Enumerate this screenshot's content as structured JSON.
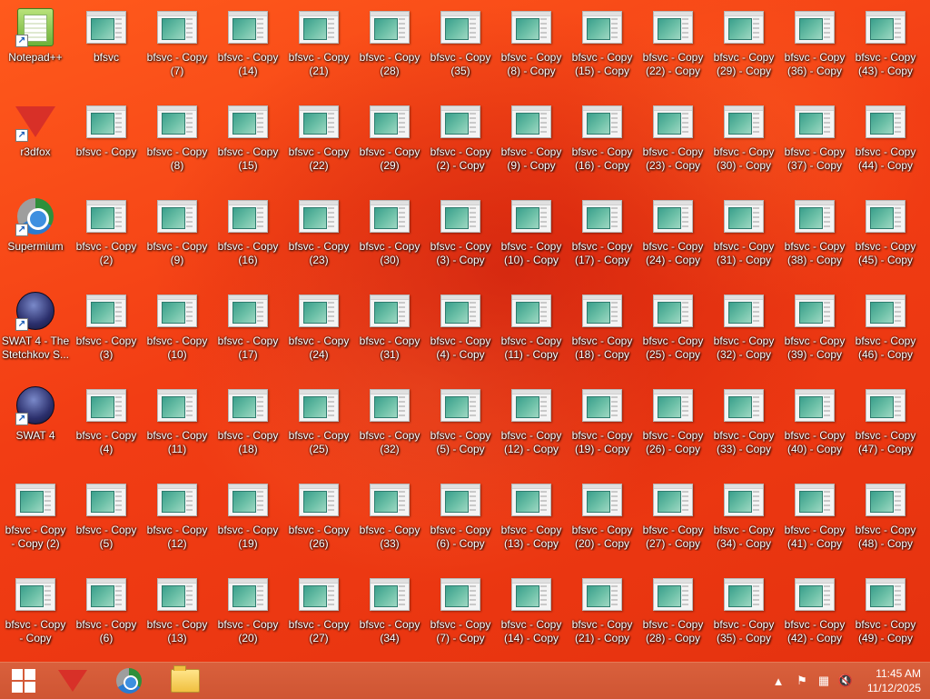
{
  "desktop": {
    "shortcuts": [
      {
        "label": "Notepad++",
        "icon": "notepad-plus-plus-icon"
      },
      {
        "label": "r3dfox",
        "icon": "r3dfox-icon"
      },
      {
        "label": "Supermium",
        "icon": "supermium-icon"
      },
      {
        "label": "SWAT 4 - The\nStetchkov S...",
        "icon": "swat4-tss-icon"
      },
      {
        "label": "SWAT 4",
        "icon": "swat4-icon"
      },
      {
        "label": "bfsvc - Copy\n- Copy (2)",
        "icon": "executable-icon"
      },
      {
        "label": "bfsvc - Copy\n- Copy",
        "icon": "executable-icon"
      }
    ],
    "file_labels": [
      [
        "bfsvc",
        "bfsvc - Copy\n(7)",
        "bfsvc - Copy\n(14)",
        "bfsvc - Copy\n(21)",
        "bfsvc - Copy\n(28)",
        "bfsvc - Copy\n(35)",
        "bfsvc - Copy\n(8) - Copy",
        "bfsvc - Copy\n(15) - Copy",
        "bfsvc - Copy\n(22) - Copy",
        "bfsvc - Copy\n(29) - Copy",
        "bfsvc - Copy\n(36) - Copy",
        "bfsvc - Copy\n(43) - Copy"
      ],
      [
        "bfsvc - Copy",
        "bfsvc - Copy\n(8)",
        "bfsvc - Copy\n(15)",
        "bfsvc - Copy\n(22)",
        "bfsvc - Copy\n(29)",
        "bfsvc - Copy\n(2) - Copy",
        "bfsvc - Copy\n(9) - Copy",
        "bfsvc - Copy\n(16) - Copy",
        "bfsvc - Copy\n(23) - Copy",
        "bfsvc - Copy\n(30) - Copy",
        "bfsvc - Copy\n(37) - Copy",
        "bfsvc - Copy\n(44) - Copy"
      ],
      [
        "bfsvc - Copy\n(2)",
        "bfsvc - Copy\n(9)",
        "bfsvc - Copy\n(16)",
        "bfsvc - Copy\n(23)",
        "bfsvc - Copy\n(30)",
        "bfsvc - Copy\n(3) - Copy",
        "bfsvc - Copy\n(10) - Copy",
        "bfsvc - Copy\n(17) - Copy",
        "bfsvc - Copy\n(24) - Copy",
        "bfsvc - Copy\n(31) - Copy",
        "bfsvc - Copy\n(38) - Copy",
        "bfsvc - Copy\n(45) - Copy"
      ],
      [
        "bfsvc - Copy\n(3)",
        "bfsvc - Copy\n(10)",
        "bfsvc - Copy\n(17)",
        "bfsvc - Copy\n(24)",
        "bfsvc - Copy\n(31)",
        "bfsvc - Copy\n(4) - Copy",
        "bfsvc - Copy\n(11) - Copy",
        "bfsvc - Copy\n(18) - Copy",
        "bfsvc - Copy\n(25) - Copy",
        "bfsvc - Copy\n(32) - Copy",
        "bfsvc - Copy\n(39) - Copy",
        "bfsvc - Copy\n(46) - Copy"
      ],
      [
        "bfsvc - Copy\n(4)",
        "bfsvc - Copy\n(11)",
        "bfsvc - Copy\n(18)",
        "bfsvc - Copy\n(25)",
        "bfsvc - Copy\n(32)",
        "bfsvc - Copy\n(5) - Copy",
        "bfsvc - Copy\n(12) - Copy",
        "bfsvc - Copy\n(19) - Copy",
        "bfsvc - Copy\n(26) - Copy",
        "bfsvc - Copy\n(33) - Copy",
        "bfsvc - Copy\n(40) - Copy",
        "bfsvc - Copy\n(47) - Copy"
      ],
      [
        "bfsvc - Copy\n(5)",
        "bfsvc - Copy\n(12)",
        "bfsvc - Copy\n(19)",
        "bfsvc - Copy\n(26)",
        "bfsvc - Copy\n(33)",
        "bfsvc - Copy\n(6) - Copy",
        "bfsvc - Copy\n(13) - Copy",
        "bfsvc - Copy\n(20) - Copy",
        "bfsvc - Copy\n(27) - Copy",
        "bfsvc - Copy\n(34) - Copy",
        "bfsvc - Copy\n(41) - Copy",
        "bfsvc - Copy\n(48) - Copy"
      ],
      [
        "bfsvc - Copy\n(6)",
        "bfsvc - Copy\n(13)",
        "bfsvc - Copy\n(20)",
        "bfsvc - Copy\n(27)",
        "bfsvc - Copy\n(34)",
        "bfsvc - Copy\n(7) - Copy",
        "bfsvc - Copy\n(14) - Copy",
        "bfsvc - Copy\n(21) - Copy",
        "bfsvc - Copy\n(28) - Copy",
        "bfsvc - Copy\n(35) - Copy",
        "bfsvc - Copy\n(42) - Copy",
        "bfsvc - Copy\n(49) - Copy"
      ]
    ]
  },
  "taskbar": {
    "pinned": [
      {
        "icon": "windows-start-icon"
      },
      {
        "icon": "r3dfox-icon"
      },
      {
        "icon": "supermium-icon"
      },
      {
        "icon": "file-explorer-icon"
      }
    ],
    "tray_icons": [
      "show-hidden-icons-chevron",
      "action-center-flag-icon",
      "network-icon",
      "volume-muted-icon"
    ],
    "clock": {
      "time": "11:45 AM",
      "date": "11/12/2025"
    }
  },
  "colors": {
    "desktop_accent": "#f23d14",
    "taskbar": "#d45a37"
  }
}
